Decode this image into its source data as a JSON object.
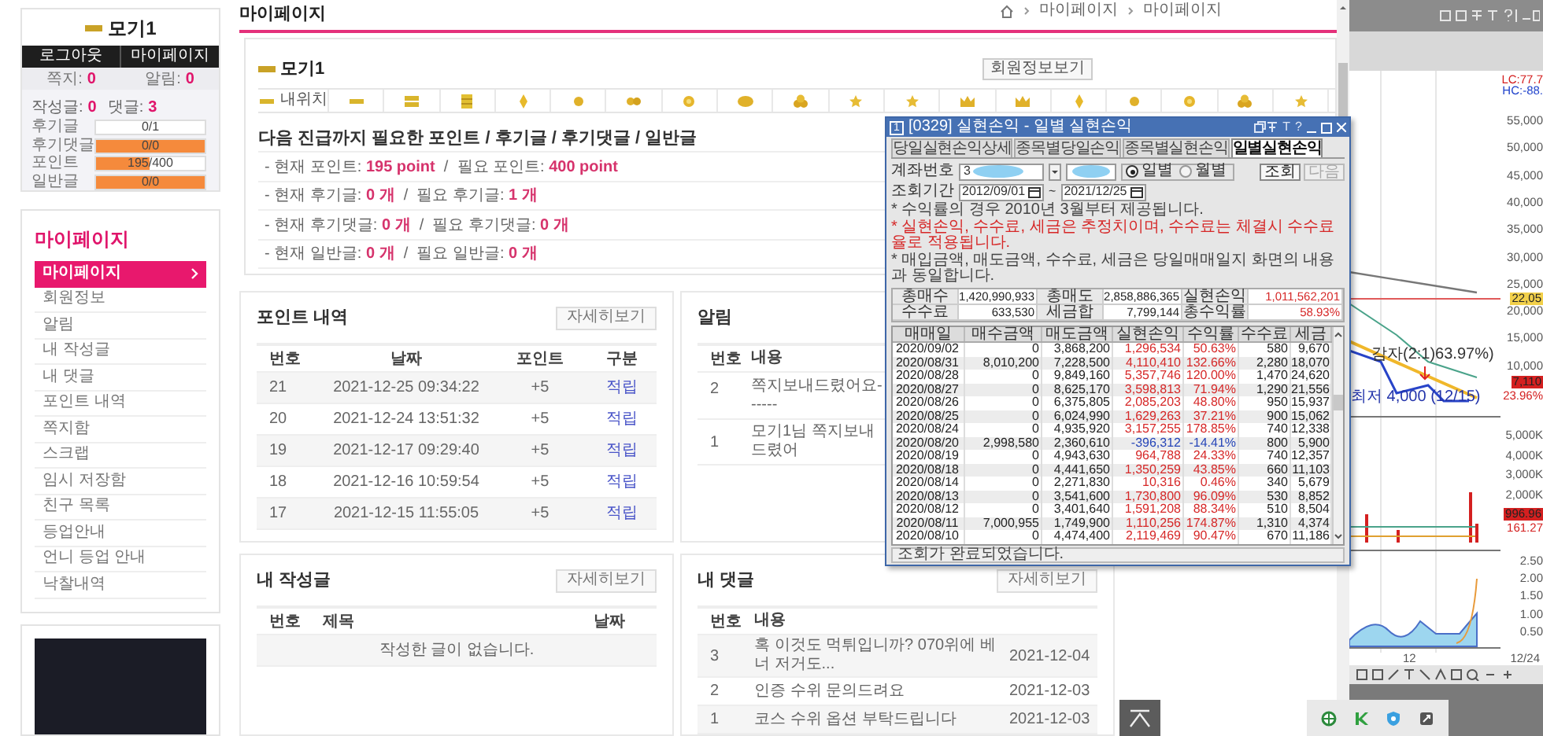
{
  "sidebar_profile": {
    "name": "모기1",
    "buttons": [
      "로그아웃",
      "마이페이지"
    ],
    "counts": [
      {
        "label": "쪽지:",
        "value": "0"
      },
      {
        "label": "알림:",
        "value": "0"
      }
    ],
    "posts": [
      {
        "label": "작성글:",
        "value": "0"
      },
      {
        "label": "댓글:",
        "value": "3"
      }
    ],
    "progress": [
      {
        "label": "후기글",
        "reading": "0/1",
        "level": 0
      },
      {
        "label": "후기댓글",
        "reading": "0/0",
        "level": 1
      },
      {
        "label": "포인트",
        "reading": "195/400",
        "level": 0.4875
      },
      {
        "label": "일반글",
        "reading": "0/0",
        "level": 1
      }
    ]
  },
  "sidebar_menu": {
    "title": "마이페이지",
    "items": [
      {
        "label": "마이페이지",
        "selected": true
      },
      {
        "label": "회원정보",
        "selected": false
      },
      {
        "label": "알림",
        "selected": false
      },
      {
        "label": "내 작성글",
        "selected": false
      },
      {
        "label": "내 댓글",
        "selected": false
      },
      {
        "label": "포인트 내역",
        "selected": false
      },
      {
        "label": "쪽지함",
        "selected": false
      },
      {
        "label": "스크랩",
        "selected": false
      },
      {
        "label": "임시 저장함",
        "selected": false
      },
      {
        "label": "친구 목록",
        "selected": false
      },
      {
        "label": "등업안내",
        "selected": false
      },
      {
        "label": "언니 등업 안내",
        "selected": false
      },
      {
        "label": "낙찰내역",
        "selected": false
      }
    ]
  },
  "page": {
    "title": "마이페이지",
    "breadcrumbs": [
      "마이페이지",
      "마이페이지"
    ]
  },
  "profile": {
    "name": "모기1",
    "button": "회원정보보기",
    "levels": [
      {
        "label": "내위치",
        "kind": "bar"
      },
      {
        "kind": "bar"
      },
      {
        "kind": "bar-double"
      },
      {
        "kind": "bar-triple"
      },
      {
        "kind": "gem"
      },
      {
        "kind": "medal"
      },
      {
        "kind": "medal-double"
      },
      {
        "kind": "sun"
      },
      {
        "kind": "medal-wide"
      },
      {
        "kind": "coins"
      },
      {
        "kind": "star"
      },
      {
        "kind": "star"
      },
      {
        "kind": "crown"
      },
      {
        "kind": "crown"
      },
      {
        "kind": "gem"
      },
      {
        "kind": "medal"
      },
      {
        "kind": "sun"
      },
      {
        "kind": "coins"
      },
      {
        "kind": "star"
      }
    ],
    "heading": "다음 진급까지 필요한 포인트 / 후기글 / 후기댓글 / 일반글",
    "lines": [
      "- 현재 포인트: **195 point**  /  필요 포인트: **400 point**",
      "- 현재 후기글: **0 개**  /  필요 후기글: **1 개**",
      "- 현재 후기댓글: **0 개**  /  필요 후기댓글: **0 개**",
      "- 현재 일반글: **0 개**  /  필요 일반글: **0 개**"
    ]
  },
  "point_history": {
    "title": "포인트 내역",
    "button": "자세히보기",
    "columns": [
      "번호",
      "날짜",
      "포인트",
      "구분"
    ],
    "rows": [
      [
        "21",
        "2021-12-25 09:34:22",
        "+5",
        "적립"
      ],
      [
        "20",
        "2021-12-24 13:51:32",
        "+5",
        "적립"
      ],
      [
        "19",
        "2021-12-17 09:29:40",
        "+5",
        "적립"
      ],
      [
        "18",
        "2021-12-16 10:59:54",
        "+5",
        "적립"
      ],
      [
        "17",
        "2021-12-15 11:55:05",
        "+5",
        "적립"
      ]
    ]
  },
  "notifications": {
    "title": "알림",
    "columns": [
      "번호",
      "내용"
    ],
    "rows": [
      [
        "2",
        "쪽지보내드렸어요------"
      ],
      [
        "1",
        "모기1님 쪽지보내드렸어"
      ]
    ]
  },
  "my_posts": {
    "title": "내 작성글",
    "button": "자세히보기",
    "columns": [
      "번호",
      "제목",
      "날짜"
    ],
    "empty": "작성한 글이 없습니다."
  },
  "my_comments": {
    "title": "내 댓글",
    "button": "자세히보기",
    "columns": [
      "번호",
      "내용"
    ],
    "rows": [
      [
        "3",
        "혹 이것도 먹튀입니까? 070위에 베너 저거도...",
        "2021-12-04"
      ],
      [
        "2",
        "인증 수위 문의드려요",
        "2021-12-03"
      ],
      [
        "1",
        "코스 수위 옵션 부탁드립니다",
        "2021-12-03"
      ]
    ]
  },
  "popup": {
    "badge": "1",
    "title": "[0329] 실현손익 - 일별 실현손익",
    "title_glyphs": [
      "T",
      "?"
    ],
    "tabs": [
      {
        "label": "당일실현손익상세",
        "selected": false
      },
      {
        "label": "종목별당일손익",
        "selected": false
      },
      {
        "label": "종목별실현손익",
        "selected": false
      },
      {
        "label": "일별실현손익",
        "selected": true
      }
    ],
    "account_label": "계좌번호",
    "account_value": "3",
    "radios": [
      {
        "label": "일별",
        "selected": true
      },
      {
        "label": "월별",
        "selected": false
      }
    ],
    "buttons": [
      {
        "label": "조회",
        "disabled": false
      },
      {
        "label": "다음",
        "disabled": true
      }
    ],
    "period_label": "조회기간",
    "date_from": "2012/09/01",
    "date_sep": "~",
    "date_to": "2021/12/25",
    "notes": [
      {
        "text": "* 수익률의 경우 2010년 3월부터 제공됩니다.",
        "kind": "info"
      },
      {
        "text": "* 실현손익, 수수료, 세금은 추정치이며, 수수료는 체결시 수수료율로 적용됩니다.",
        "kind": "warning"
      },
      {
        "text": "* 매입금액, 매도금액, 수수료, 세금은 당일매매일지 화면의 내용과 동일합니다.",
        "kind": "info"
      }
    ],
    "summary": [
      [
        {
          "label": "총매수",
          "value": "1,420,990,933"
        },
        {
          "label": "총매도",
          "value": "2,858,886,365"
        },
        {
          "label": "실현손익",
          "value": "1,011,562,201",
          "kind": "profit"
        }
      ],
      [
        {
          "label": "수수료",
          "value": "633,530"
        },
        {
          "label": "세금합",
          "value": "7,799,144"
        },
        {
          "label": "총수익률",
          "value": "58.93%",
          "kind": "profit"
        }
      ]
    ],
    "columns": [
      "매매일",
      "매수금액",
      "매도금액",
      "실현손익",
      "수익률",
      "수수료",
      "세금"
    ],
    "rows": [
      {
        "kind": "profit",
        "cells": [
          "2020/09/02",
          "0",
          "3,868,200",
          "1,296,534",
          "50.63%",
          "580",
          "9,670"
        ]
      },
      {
        "kind": "profit",
        "cells": [
          "2020/08/31",
          "8,010,200",
          "7,228,500",
          "4,110,410",
          "132.66%",
          "2,280",
          "18,070"
        ]
      },
      {
        "kind": "profit",
        "cells": [
          "2020/08/28",
          "0",
          "9,849,160",
          "5,357,746",
          "120.00%",
          "1,470",
          "24,620"
        ]
      },
      {
        "kind": "profit",
        "cells": [
          "2020/08/27",
          "0",
          "8,625,170",
          "3,598,813",
          "71.94%",
          "1,290",
          "21,556"
        ]
      },
      {
        "kind": "profit",
        "cells": [
          "2020/08/26",
          "0",
          "6,375,805",
          "2,085,203",
          "48.80%",
          "950",
          "15,937"
        ]
      },
      {
        "kind": "profit",
        "cells": [
          "2020/08/25",
          "0",
          "6,024,990",
          "1,629,263",
          "37.21%",
          "900",
          "15,062"
        ]
      },
      {
        "kind": "profit",
        "cells": [
          "2020/08/24",
          "0",
          "4,935,920",
          "3,157,255",
          "178.85%",
          "740",
          "12,338"
        ]
      },
      {
        "kind": "loss",
        "cells": [
          "2020/08/20",
          "2,998,580",
          "2,360,610",
          "-396,312",
          "-14.41%",
          "800",
          "5,900"
        ]
      },
      {
        "kind": "profit",
        "cells": [
          "2020/08/19",
          "0",
          "4,943,630",
          "964,788",
          "24.33%",
          "740",
          "12,357"
        ]
      },
      {
        "kind": "profit",
        "cells": [
          "2020/08/18",
          "0",
          "4,441,650",
          "1,350,259",
          "43.85%",
          "660",
          "11,103"
        ]
      },
      {
        "kind": "profit",
        "cells": [
          "2020/08/14",
          "0",
          "2,271,830",
          "10,316",
          "0.46%",
          "340",
          "5,679"
        ]
      },
      {
        "kind": "profit",
        "cells": [
          "2020/08/13",
          "0",
          "3,541,600",
          "1,730,800",
          "96.09%",
          "530",
          "8,852"
        ]
      },
      {
        "kind": "profit",
        "cells": [
          "2020/08/12",
          "0",
          "3,401,640",
          "1,591,208",
          "88.34%",
          "510",
          "8,504"
        ]
      },
      {
        "kind": "profit",
        "cells": [
          "2020/08/11",
          "7,000,955",
          "1,749,900",
          "1,110,256",
          "174.87%",
          "1,310",
          "4,374"
        ]
      },
      {
        "kind": "profit",
        "cells": [
          "2020/08/10",
          "0",
          "4,474,400",
          "2,119,469",
          "90.47%",
          "670",
          "11,186"
        ]
      }
    ],
    "status": "조회가 완료되었습니다."
  },
  "chart": {
    "header_labels": [
      {
        "text": "LC:77.7",
        "kind": "low"
      },
      {
        "text": "HC:-88.",
        "kind": "high"
      }
    ],
    "price_ticks": [
      "55,000",
      "50,000",
      "45,000",
      "40,000",
      "35,000",
      "30,000",
      "25,000",
      "20,000",
      "15,000",
      "10,000"
    ],
    "volume_ticks": [
      "5,000K",
      "4,000K",
      "3,000K",
      "2,000K"
    ],
    "indicator_ticks": [
      "2.50",
      "2.00",
      "1.50",
      "1.00",
      "0.50"
    ],
    "annotations": [
      {
        "text": "감자(2:1)63.97%)",
        "kind": "event"
      },
      {
        "text": "최저 4,000 (12/15)",
        "kind": "low"
      }
    ],
    "value_tags": [
      {
        "text": "22,05",
        "color": "#f2d04a"
      },
      {
        "text": "7,110",
        "color": "#d42020"
      },
      {
        "text": "996.96",
        "color": "#d42020"
      }
    ],
    "value_notes": [
      "23.96%",
      "161.27"
    ],
    "date_labels": [
      "12",
      "12/24"
    ]
  }
}
